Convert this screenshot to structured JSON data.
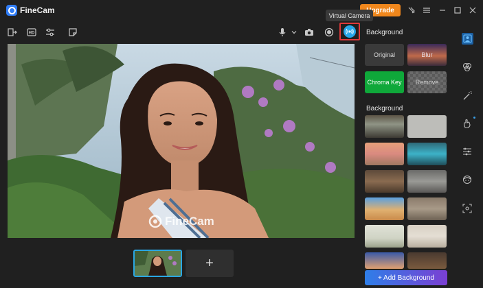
{
  "app": {
    "title": "FineCam",
    "upgrade_label": "Upgrade"
  },
  "tooltip": {
    "text": "Virtual Camera"
  },
  "panel": {
    "section1_title": "Background",
    "options": [
      {
        "label": "Original"
      },
      {
        "label": "Blur"
      },
      {
        "label": "Chroma Key"
      },
      {
        "label": "Remove"
      }
    ],
    "section2_title": "Background",
    "add_background_label": "+ Add Background"
  },
  "preview": {
    "watermark": "FineCam"
  },
  "thumbnails": {
    "add_label": "+"
  },
  "colors": {
    "accent": "#27a6e8",
    "upgrade": "#f0871c",
    "chroma": "#0fa83a",
    "highlight": "#e0383a"
  },
  "icons": {
    "toolbar": [
      "exit-icon",
      "hd-icon",
      "sliders-icon",
      "sticker-icon",
      "mic-icon",
      "camera-icon",
      "record-icon",
      "virtual-camera-icon"
    ],
    "window": [
      "pin-icon",
      "menu-icon",
      "minimize-icon",
      "maximize-icon",
      "close-icon"
    ],
    "strip": [
      "person-icon",
      "filter-icon",
      "magic-wand-icon",
      "hand-icon",
      "adjust-icon",
      "face-icon",
      "scan-icon"
    ]
  }
}
